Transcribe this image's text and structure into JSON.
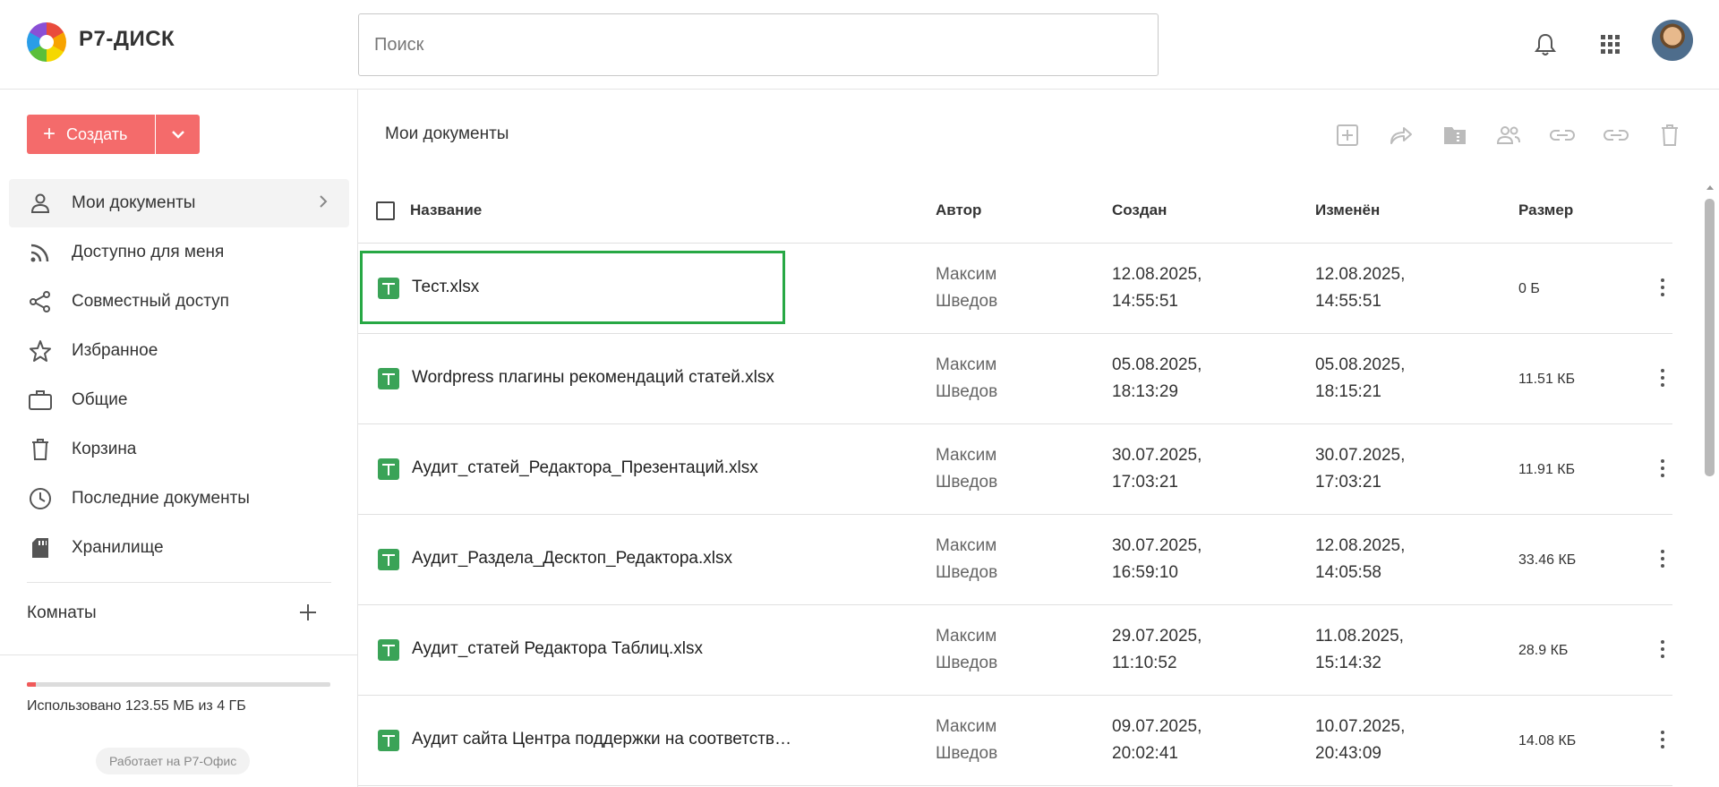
{
  "header": {
    "logo_text": "Р7-ДИСК",
    "search_placeholder": "Поиск"
  },
  "sidebar": {
    "create_label": "Создать",
    "items": [
      {
        "label": "Мои документы",
        "icon": "person-icon",
        "active": true
      },
      {
        "label": "Доступно для меня",
        "icon": "rss-icon"
      },
      {
        "label": "Совместный доступ",
        "icon": "share-icon"
      },
      {
        "label": "Избранное",
        "icon": "star-icon"
      },
      {
        "label": "Общие",
        "icon": "briefcase-icon"
      },
      {
        "label": "Корзина",
        "icon": "trash-icon"
      },
      {
        "label": "Последние документы",
        "icon": "clock-icon"
      },
      {
        "label": "Хранилище",
        "icon": "storage-icon"
      }
    ],
    "rooms_label": "Комнаты",
    "quota_text": "Использовано 123.55 МБ из 4 ГБ",
    "quota_fraction": 0.03,
    "powered_by": "Работает на Р7-Офис"
  },
  "main": {
    "breadcrumb": "Мои документы",
    "columns": {
      "name": "Название",
      "author": "Автор",
      "created": "Создан",
      "modified": "Изменён",
      "size": "Размер"
    },
    "rows": [
      {
        "name": "Тест.xlsx",
        "author_1": "Максим",
        "author_2": "Шведов",
        "created_date": "12.08.2025,",
        "created_time": "14:55:51",
        "modified_date": "12.08.2025,",
        "modified_time": "14:55:51",
        "size": "0 Б"
      },
      {
        "name": "Wordpress плагины рекомендаций статей.xlsx",
        "author_1": "Максим",
        "author_2": "Шведов",
        "created_date": "05.08.2025,",
        "created_time": "18:13:29",
        "modified_date": "05.08.2025,",
        "modified_time": "18:15:21",
        "size": "11.51 КБ"
      },
      {
        "name": "Аудит_статей_Редактора_Презентаций.xlsx",
        "author_1": "Максим",
        "author_2": "Шведов",
        "created_date": "30.07.2025,",
        "created_time": "17:03:21",
        "modified_date": "30.07.2025,",
        "modified_time": "17:03:21",
        "size": "11.91 КБ"
      },
      {
        "name": "Аудит_Раздела_Десктоп_Редактора.xlsx",
        "author_1": "Максим",
        "author_2": "Шведов",
        "created_date": "30.07.2025,",
        "created_time": "16:59:10",
        "modified_date": "12.08.2025,",
        "modified_time": "14:05:58",
        "size": "33.46 КБ"
      },
      {
        "name": "Аудит_статей Редактора Таблиц.xlsx",
        "author_1": "Максим",
        "author_2": "Шведов",
        "created_date": "29.07.2025,",
        "created_time": "11:10:52",
        "modified_date": "11.08.2025,",
        "modified_time": "15:14:32",
        "size": "28.9 КБ"
      },
      {
        "name": "Аудит сайта Центра поддержки на соответствие ново…",
        "author_1": "Максим",
        "author_2": "Шведов",
        "created_date": "09.07.2025,",
        "created_time": "20:02:41",
        "modified_date": "10.07.2025,",
        "modified_time": "20:43:09",
        "size": "14.08 КБ"
      }
    ]
  },
  "colors": {
    "accent": "#f46b6b",
    "selection": "#27a844",
    "spreadsheet_icon": "#3aa357"
  }
}
